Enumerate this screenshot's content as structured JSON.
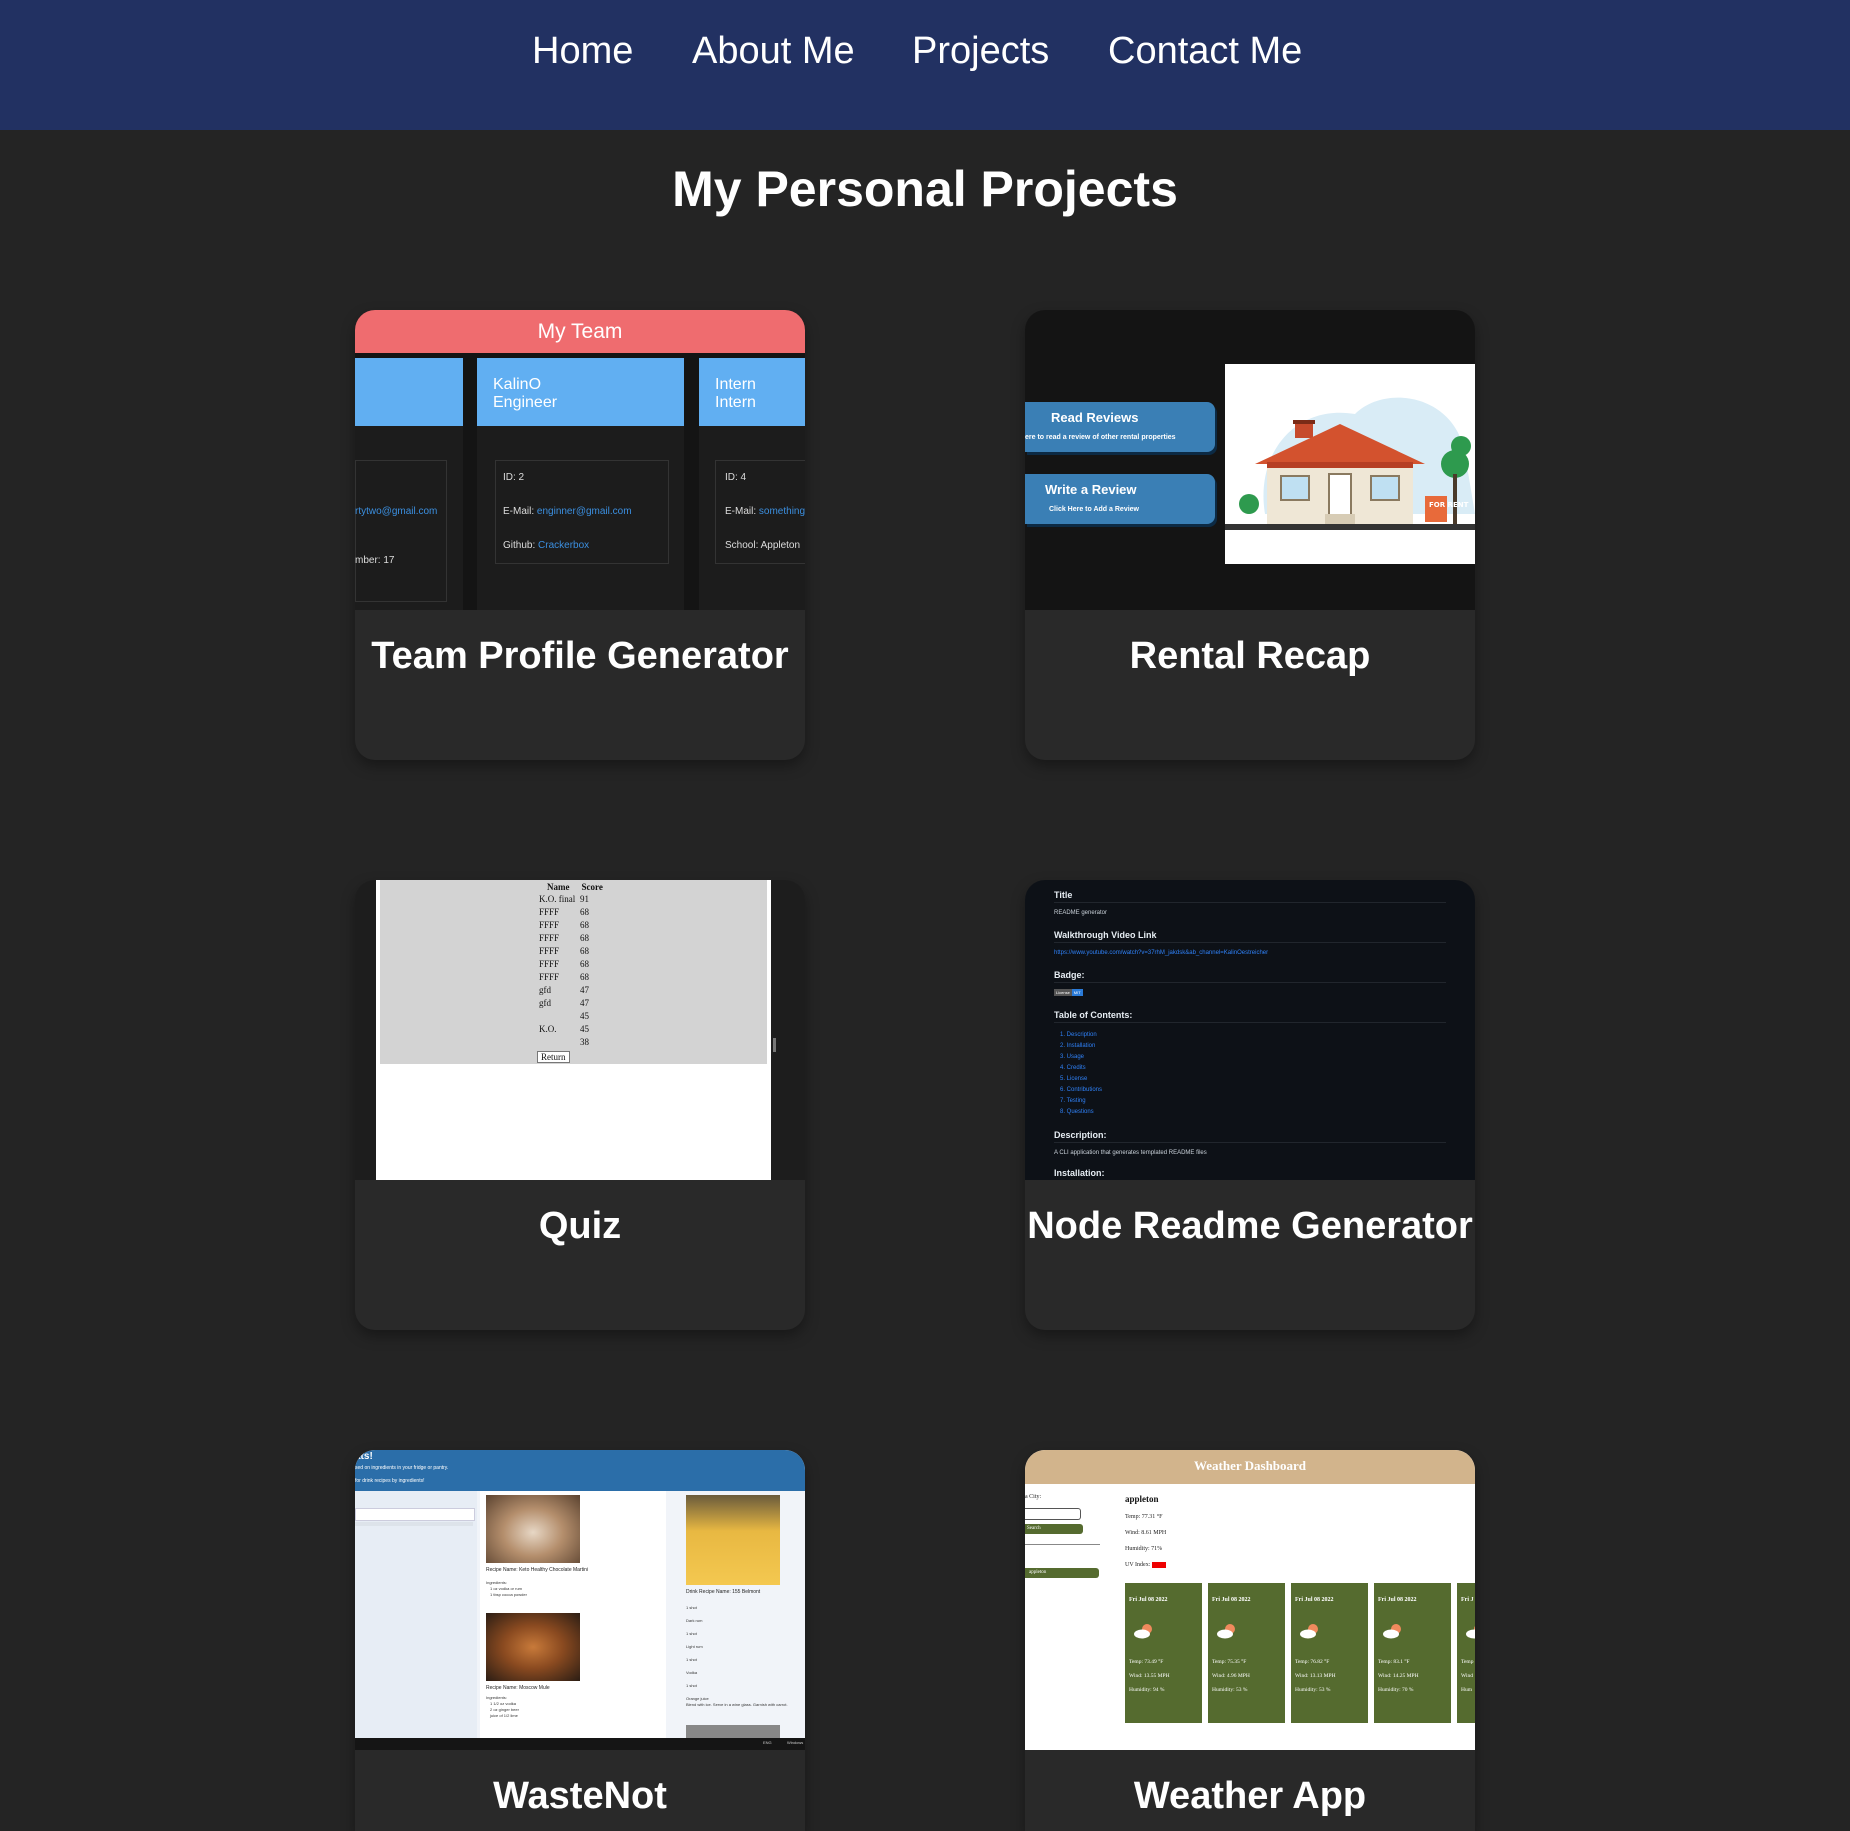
{
  "nav": {
    "items": [
      "Home",
      "About Me",
      "Projects",
      "Contact Me"
    ]
  },
  "page": {
    "heading": "My Personal Projects"
  },
  "colors": {
    "nav_bg": "#223162",
    "page_bg": "#242424",
    "card_bg": "#292929"
  },
  "projects": [
    {
      "title": "Team Profile Generator",
      "screenshot": {
        "header": "My Team",
        "col2_name": "KalinO",
        "col2_role": "Engineer",
        "col3_name": "Intern",
        "col3_role": "Intern",
        "col1_email": "rtytwo@gmail.com",
        "col1_office": "mber: 17",
        "col2_id": "ID: 2",
        "col2_email_label": "E-Mail:",
        "col2_email": "enginner@gmail.com",
        "col2_github_label": "Github:",
        "col2_github": "Crackerbox",
        "col3_id": "ID: 4",
        "col3_email_label": "E-Mail:",
        "col3_email": "something",
        "col3_school": "School: Appleton"
      }
    },
    {
      "title": "Rental Recap",
      "screenshot": {
        "read_title": "Read Reviews",
        "read_sub": "ere to read a review of other rental properties",
        "write_title": "Write a Review",
        "write_sub": "Click Here to Add a Review",
        "sign": "FOR RENT"
      }
    },
    {
      "title": "Quiz",
      "screenshot": {
        "col_name": "Name",
        "col_score": "Score",
        "rows": [
          {
            "name": "K.O. final",
            "score": "91"
          },
          {
            "name": "FFFF",
            "score": "68"
          },
          {
            "name": "FFFF",
            "score": "68"
          },
          {
            "name": "FFFF",
            "score": "68"
          },
          {
            "name": "FFFF",
            "score": "68"
          },
          {
            "name": "FFFF",
            "score": "68"
          },
          {
            "name": "FFFF",
            "score": "68"
          },
          {
            "name": "gfd",
            "score": "47"
          },
          {
            "name": "gfd",
            "score": "47"
          },
          {
            "name": "",
            "score": "45"
          },
          {
            "name": "K.O.",
            "score": "45"
          },
          {
            "name": "",
            "score": "38"
          }
        ],
        "button": "Return"
      }
    },
    {
      "title": "Node Readme Generator",
      "screenshot": {
        "title_label": "Title",
        "title_value": "README generator",
        "video_label": "Walkthrough Video Link",
        "video_url": "https://www.youtube.com/watch?v=37rhM_jakdsk&ab_channel=KalinOestreicher",
        "badge_label": "Badge:",
        "badge_left": "License",
        "badge_right": "MIT",
        "toc_label": "Table of Contents:",
        "toc": [
          "1. Description",
          "2. Installation",
          "3. Usage",
          "4. Credits",
          "5. License",
          "6. Contributions",
          "7. Testing",
          "8. Questions"
        ],
        "desc_label": "Description:",
        "desc_value": "A CLI application that generates templated README files",
        "install_label": "Installation:"
      }
    },
    {
      "title": "WasteNot",
      "screenshot": {
        "banner_title": "ats!",
        "banner_line1": "sed on ingredients in your fridge or pantry.",
        "banner_line2": "for drink recipes by ingredients!",
        "recipe1": "Recipe Name: Keto Healthy Chocolate Martini",
        "recipe2": "Recipe Name: Moscow Mule",
        "drink1": "Drink Recipe Name: 155 Belmont",
        "ingredients": "Ingredients:",
        "ing1": "1 oz vodka or rum",
        "ing2": "1 tbsp cocoa powder",
        "ing3": "1 1/2 oz vodka",
        "ing4": "2 oz ginger beer",
        "ing5": "juice of 1/2 lime",
        "d1": "1 shot",
        "d2": "Dark rum",
        "d3": "1 shot",
        "d4": "Light rum",
        "d5": "1 shot",
        "d6": "Vodka",
        "d7": "1 shot",
        "d8": "Orange juice",
        "d9": "Blend with ice. Serve in a wine glass. Garnish with carrot.",
        "foot1": "ENG",
        "foot2": "Windows"
      }
    },
    {
      "title": "Weather App",
      "screenshot": {
        "header": "Weather Dashboard",
        "city_label": "a City:",
        "search_btn": "Search",
        "history_btn": "appleton",
        "city": "appleton",
        "temp": "Temp: 77.31 °F",
        "wind": "Wind: 8.61 MPH",
        "humidity": "Humidity: 71%",
        "uv_label": "UV Index:",
        "uv_value": "7.53",
        "forecast": [
          {
            "date": "Fri Jul 08 2022",
            "temp": "Temp: 73.49 °F",
            "wind": "Wind: 13.55 MPH",
            "hum": "Humidity: 94 %"
          },
          {
            "date": "Fri Jul 08 2022",
            "temp": "Temp: 75.35 °F",
            "wind": "Wind: 4.96 MPH",
            "hum": "Humidity: 53 %"
          },
          {
            "date": "Fri Jul 08 2022",
            "temp": "Temp: 76.82 °F",
            "wind": "Wind: 13.13 MPH",
            "hum": "Humidity: 53 %"
          },
          {
            "date": "Fri Jul 08 2022",
            "temp": "Temp: 83.1 °F",
            "wind": "Wind: 14.25 MPH",
            "hum": "Humidity: 70 %"
          },
          {
            "date": "Fri J",
            "temp": "Temp",
            "wind": "Wind",
            "hum": "Hum"
          }
        ]
      }
    }
  ]
}
